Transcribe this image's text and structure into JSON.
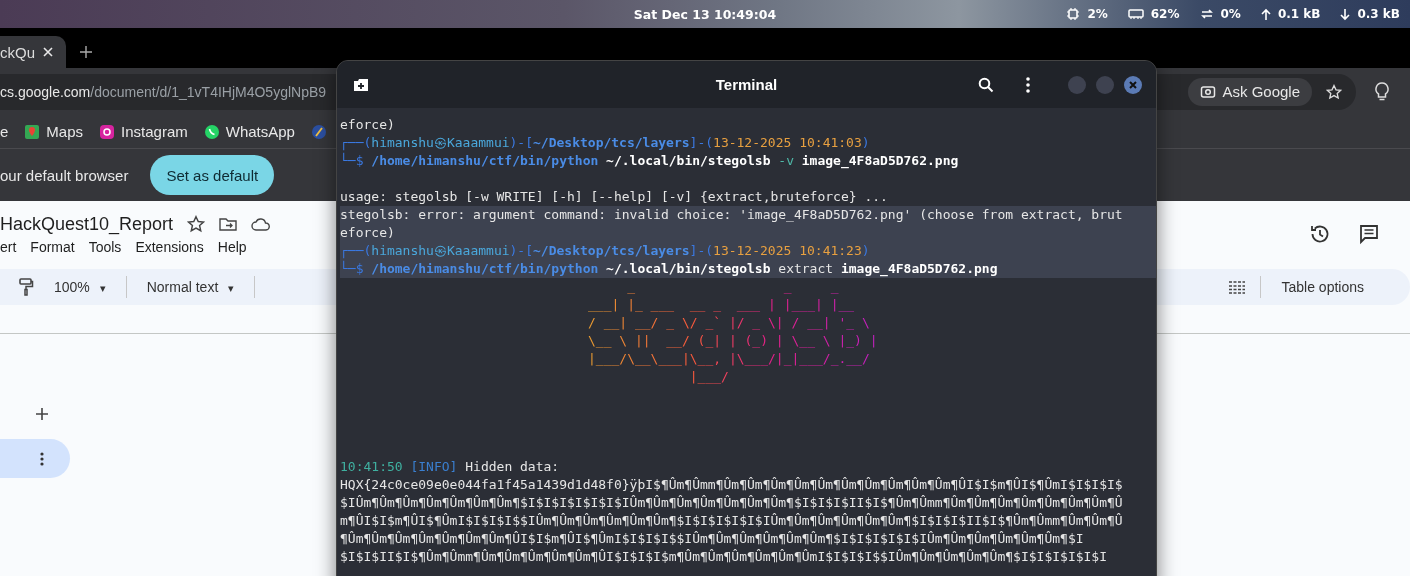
{
  "top_bar": {
    "clock": "Sat Dec 13  10:49:04",
    "status": [
      {
        "kind": "cpu",
        "text": "2%"
      },
      {
        "kind": "memory",
        "text": "62%"
      },
      {
        "kind": "swap",
        "text": "0%"
      },
      {
        "kind": "upload",
        "text": "0.1 kB"
      },
      {
        "kind": "download",
        "text": "0.3 kB"
      }
    ]
  },
  "browser": {
    "tab": {
      "title": "ckQu"
    },
    "address": {
      "host": "cs.google.com",
      "path": "/document/d/1_1vT4IHjM4O5yglNpB9"
    },
    "ask_button": "Ask Google",
    "bookmarks": [
      {
        "kind": "plain",
        "label": "e"
      },
      {
        "kind": "maps",
        "label": "Maps"
      },
      {
        "kind": "instagram",
        "label": "Instagram"
      },
      {
        "kind": "whatsapp",
        "label": "WhatsApp"
      },
      {
        "kind": "feather"
      }
    ],
    "infobar": {
      "message": "our default browser",
      "button": "Set as default"
    }
  },
  "docs": {
    "title": "HackQuest10_Report",
    "menu": [
      "ert",
      "Format",
      "Tools",
      "Extensions",
      "Help"
    ],
    "zoom": "100%",
    "style": "Normal text",
    "caret": "▾",
    "table_options": "Table options"
  },
  "terminal": {
    "title": "Terminal",
    "lines": [
      {
        "kind": "text",
        "highlighted": false,
        "segments": [
          {
            "kind": "plain",
            "text": "eforce)"
          }
        ]
      },
      {
        "kind": "text",
        "highlighted": false,
        "segments": [
          {
            "kind": "frame",
            "text": "┌──("
          },
          {
            "kind": "host",
            "text": "himanshu㉿Kaaammui"
          },
          {
            "kind": "frame",
            "text": ")-["
          },
          {
            "kind": "path",
            "text": "~/Desktop/tcs/layers"
          },
          {
            "kind": "frame",
            "text": "]-("
          },
          {
            "kind": "time",
            "text": "13-12-2025 10:41:03"
          },
          {
            "kind": "frame",
            "text": ")"
          }
        ]
      },
      {
        "kind": "text",
        "highlighted": false,
        "segments": [
          {
            "kind": "frame",
            "text": "└─$ "
          },
          {
            "kind": "path",
            "text": "/home/himanshu/ctf/bin/python"
          },
          {
            "kind": "bold",
            "text": " ~/.local/bin/stegolsb"
          },
          {
            "kind": "flag",
            "text": " -v"
          },
          {
            "kind": "bold",
            "text": " image_4F8aD5D762.png"
          }
        ]
      },
      {
        "kind": "blank"
      },
      {
        "kind": "text",
        "highlighted": false,
        "segments": [
          {
            "kind": "plain",
            "text": "usage: stegolsb [-w WRITE] [-h] [--help] [-v] {extract,bruteforce} ..."
          }
        ]
      },
      {
        "kind": "text",
        "highlighted": true,
        "segments": [
          {
            "kind": "plain",
            "text": "stegolsb: error: argument command: invalid choice: 'image_4F8aD5D762.png' (choose from extract, brut"
          }
        ]
      },
      {
        "kind": "text",
        "highlighted": true,
        "segments": [
          {
            "kind": "plain",
            "text": "eforce)"
          }
        ]
      },
      {
        "kind": "text",
        "highlighted": true,
        "segments": [
          {
            "kind": "frame",
            "text": "┌──("
          },
          {
            "kind": "host",
            "text": "himanshu㉿Kaaammui"
          },
          {
            "kind": "frame",
            "text": ")-["
          },
          {
            "kind": "path",
            "text": "~/Desktop/tcs/layers"
          },
          {
            "kind": "frame",
            "text": "]-("
          },
          {
            "kind": "time",
            "text": "13-12-2025 10:41:23"
          },
          {
            "kind": "frame",
            "text": ")"
          }
        ]
      },
      {
        "kind": "text",
        "highlighted": true,
        "segments": [
          {
            "kind": "frame",
            "text": "└─$ "
          },
          {
            "kind": "path",
            "text": "/home/himanshu/ctf/bin/python"
          },
          {
            "kind": "bold",
            "text": " ~/.local/bin/stegolsb"
          },
          {
            "kind": "plain",
            "text": " extract"
          },
          {
            "kind": "bold",
            "text": " image_4F8aD5D762.png"
          }
        ]
      },
      {
        "kind": "art",
        "rows": [
          "     _                   _     _",
          "___| |_ ___  __ _  ___ | |___| |__",
          "/ __| __/ _ \\/ _` |/ _ \\| / __| '_ \\",
          "\\__ \\ ||  __/ (_| | (_) | \\__ \\ |_) |",
          "|___/\\__\\___|\\__, |\\___/|_|___/_.__/",
          "             |___/"
        ]
      },
      {
        "kind": "blank"
      },
      {
        "kind": "blank"
      },
      {
        "kind": "blank"
      },
      {
        "kind": "blank"
      },
      {
        "kind": "text",
        "highlighted": false,
        "segments": [
          {
            "kind": "clock",
            "text": "10:41:50"
          },
          {
            "kind": "info",
            "text": " [INFO]"
          },
          {
            "kind": "plain",
            "text": " Hidden data:"
          }
        ]
      },
      {
        "kind": "text",
        "highlighted": false,
        "segments": [
          {
            "kind": "plain",
            "text": "HQX{24c0ce09e0e044fa1f45a1439d1d48f0}ÿþI$¶Ûm¶Ûmm¶Ûm¶Ûm¶Ûm¶Ûm¶Ûm¶Ûm¶Ûm¶Ûm¶Ûm¶Ûm¶ÛI$I$m¶ÛI$¶ÛmI$I$I$I$"
          }
        ]
      },
      {
        "kind": "text",
        "highlighted": false,
        "segments": [
          {
            "kind": "plain",
            "text": "$IÛm¶Ûm¶Ûm¶Ûm¶Ûm¶Ûm¶Ûm¶$I$I$I$I$I$I$IÛm¶Ûm¶Ûm¶Ûm¶Ûm¶Ûm¶Ûm¶$I$I$I$II$I$¶Ûm¶Ûmm¶Ûm¶Ûm¶Ûm¶Ûm¶Ûm¶Ûm¶Ûm¶Û"
          }
        ]
      },
      {
        "kind": "text",
        "highlighted": false,
        "segments": [
          {
            "kind": "plain",
            "text": "m¶ÛI$I$m¶ÛI$¶ÛmI$I$I$I$$IÛm¶Ûm¶Ûm¶Ûm¶Ûm¶Ûm¶$I$I$I$I$I$IÛm¶Ûm¶Ûm¶Ûm¶Ûm¶Ûm¶$I$I$I$II$I$¶Ûm¶Ûmm¶Ûm¶Ûm¶Û"
          }
        ]
      },
      {
        "kind": "text",
        "highlighted": false,
        "segments": [
          {
            "kind": "plain",
            "text": "¶Ûm¶Ûm¶Ûm¶Ûm¶Ûm¶Ûm¶Ûm¶ÛI$I$m¶ÛI$¶ÛmI$I$I$I$$IÛm¶Ûm¶Ûm¶Ûm¶Ûm¶Ûm¶$I$I$I$I$I$IÛm¶Ûm¶Ûm¶Ûm¶Ûm¶Ûm¶$I"
          }
        ]
      },
      {
        "kind": "text",
        "highlighted": false,
        "segments": [
          {
            "kind": "plain",
            "text": "$I$I$II$I$¶Ûm¶Ûmm¶Ûm¶Ûm¶Ûm¶Ûm¶Ûm¶ÛI$I$I$I$m¶Ûm¶Ûm¶Ûm¶Ûm¶Ûm¶ÛmI$I$I$I$$IÛm¶Ûm¶Ûm¶Ûm¶Ûm¶$I$I$I$I$I$I"
          }
        ]
      }
    ]
  }
}
